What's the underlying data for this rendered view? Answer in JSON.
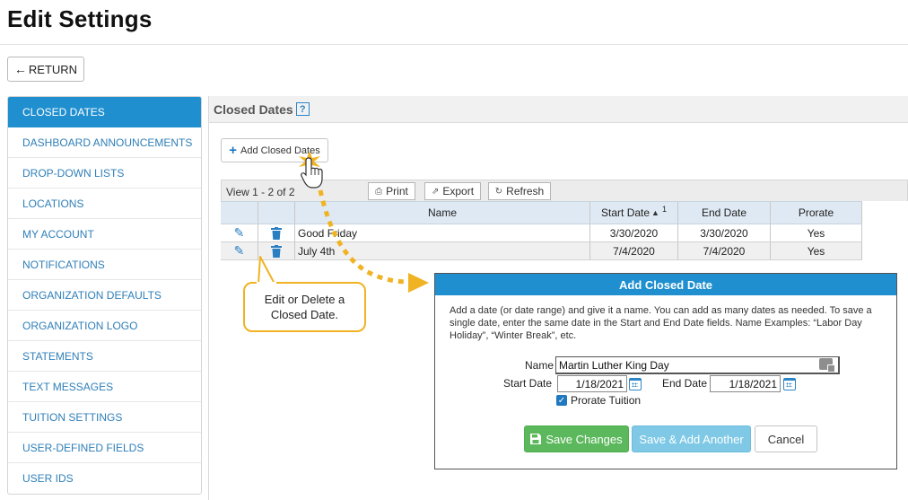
{
  "page": {
    "title": "Edit Settings"
  },
  "return_button": {
    "label": "RETURN"
  },
  "sidebar": {
    "items": [
      {
        "label": "CLOSED DATES",
        "active": true
      },
      {
        "label": "DASHBOARD ANNOUNCEMENTS"
      },
      {
        "label": "DROP-DOWN LISTS"
      },
      {
        "label": "LOCATIONS"
      },
      {
        "label": "MY ACCOUNT"
      },
      {
        "label": "NOTIFICATIONS"
      },
      {
        "label": "ORGANIZATION DEFAULTS"
      },
      {
        "label": "ORGANIZATION LOGO"
      },
      {
        "label": "STATEMENTS"
      },
      {
        "label": "TEXT MESSAGES"
      },
      {
        "label": "TUITION SETTINGS"
      },
      {
        "label": "USER-DEFINED FIELDS"
      },
      {
        "label": "USER IDS"
      }
    ]
  },
  "panel": {
    "title": "Closed Dates",
    "help_glyph": "?"
  },
  "add_button": {
    "label": "Add Closed Dates"
  },
  "grid": {
    "view_text": "View 1 - 2 of 2",
    "toolbar": {
      "print": "Print",
      "export": "Export",
      "refresh": "Refresh"
    },
    "columns": {
      "name": "Name",
      "start": "Start Date",
      "start_sort_order": "1",
      "end": "End Date",
      "prorate": "Prorate"
    },
    "rows": [
      {
        "name": "Good Friday",
        "start": "3/30/2020",
        "end": "3/30/2020",
        "prorate": "Yes"
      },
      {
        "name": "July 4th",
        "start": "7/4/2020",
        "end": "7/4/2020",
        "prorate": "Yes"
      }
    ]
  },
  "callout": {
    "text": "Edit or Delete a Closed Date."
  },
  "modal": {
    "title": "Add Closed Date",
    "description": "Add a date (or date range) and give it a name. You can add as many dates as needed. To save a single date, enter the same date in the Start and End Date fields. Name Examples: “Labor Day Holiday”, “Winter Break”, etc.",
    "name_label": "Name",
    "name_value": "Martin Luther King Day",
    "start_label": "Start Date",
    "start_value": "1/18/2021",
    "end_label": "End Date",
    "end_value": "1/18/2021",
    "prorate_label": "Prorate Tuition",
    "prorate_checked": true,
    "save_label": "Save Changes",
    "save_another_label": "Save & Add Another",
    "cancel_label": "Cancel"
  },
  "colors": {
    "accent_blue": "#1f8fcf",
    "link_blue": "#2f7fb8",
    "save_green": "#5cb85c",
    "save_another_blue": "#7fc9e6",
    "callout_orange": "#f0b323"
  },
  "icons": [
    "left-arrow-icon",
    "help-icon",
    "plus-icon",
    "printer-icon",
    "export-icon",
    "refresh-icon",
    "sort-icon",
    "pencil-icon",
    "trash-icon",
    "calendar-icon",
    "checkbox-icon",
    "save-icon",
    "keyboard-icon",
    "hand-pointer-icon",
    "dotted-arrow-icon",
    "click-burst-icon"
  ]
}
